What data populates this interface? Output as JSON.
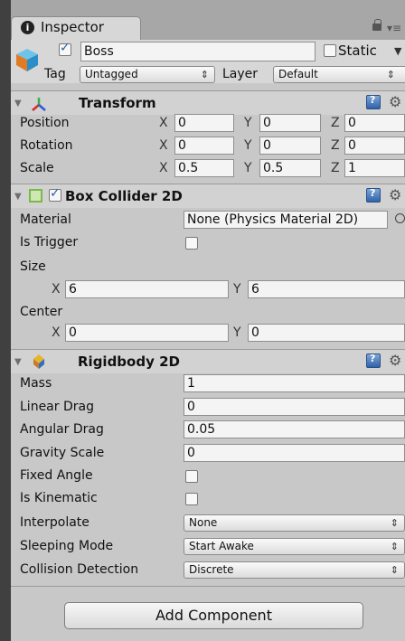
{
  "window": {
    "tab_label": "Inspector",
    "tab_icon": "info-icon",
    "lock_icon": "lock-icon",
    "menu_icon": "menu-icon"
  },
  "game_object": {
    "active_checked": true,
    "name": "Boss",
    "static_label": "Static",
    "static_checked": false,
    "tag_label": "Tag",
    "tag_value": "Untagged",
    "layer_label": "Layer",
    "layer_value": "Default"
  },
  "transform": {
    "title": "Transform",
    "position_label": "Position",
    "rotation_label": "Rotation",
    "scale_label": "Scale",
    "axis_x": "X",
    "axis_y": "Y",
    "axis_z": "Z",
    "position": {
      "x": "0",
      "y": "0",
      "z": "0"
    },
    "rotation": {
      "x": "0",
      "y": "0",
      "z": "0"
    },
    "scale": {
      "x": "0.5",
      "y": "0.5",
      "z": "1"
    }
  },
  "box_collider": {
    "title": "Box Collider 2D",
    "enabled": true,
    "material_label": "Material",
    "material_value": "None (Physics Material 2D)",
    "is_trigger_label": "Is Trigger",
    "is_trigger_checked": false,
    "size_label": "Size",
    "size": {
      "x": "6",
      "y": "6"
    },
    "center_label": "Center",
    "center": {
      "x": "0",
      "y": "0"
    },
    "axis_x": "X",
    "axis_y": "Y"
  },
  "rigidbody": {
    "title": "Rigidbody 2D",
    "mass_label": "Mass",
    "mass_value": "1",
    "linear_drag_label": "Linear Drag",
    "linear_drag_value": "0",
    "angular_drag_label": "Angular Drag",
    "angular_drag_value": "0.05",
    "gravity_scale_label": "Gravity Scale",
    "gravity_scale_value": "0",
    "fixed_angle_label": "Fixed Angle",
    "fixed_angle_checked": false,
    "is_kinematic_label": "Is Kinematic",
    "is_kinematic_checked": false,
    "interpolate_label": "Interpolate",
    "interpolate_value": "None",
    "sleeping_mode_label": "Sleeping Mode",
    "sleeping_mode_value": "Start Awake",
    "collision_detection_label": "Collision Detection",
    "collision_detection_value": "Discrete"
  },
  "add_component_label": "Add Component"
}
